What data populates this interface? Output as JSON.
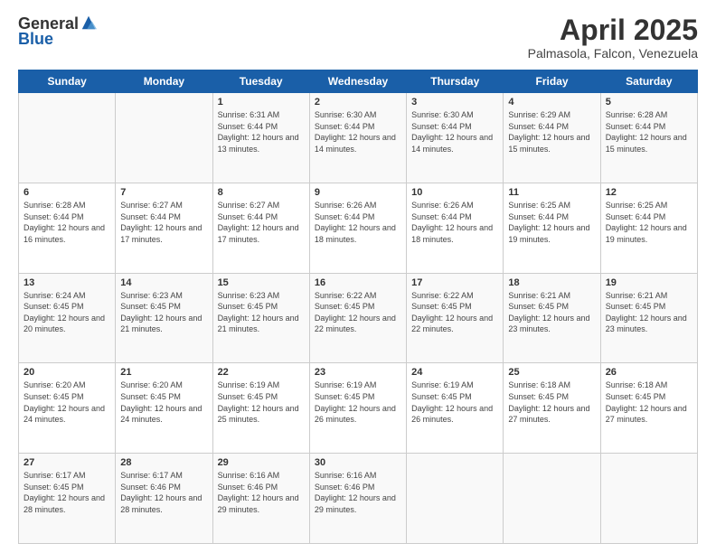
{
  "header": {
    "logo_general": "General",
    "logo_blue": "Blue",
    "month_year": "April 2025",
    "location": "Palmasola, Falcon, Venezuela"
  },
  "weekdays": [
    "Sunday",
    "Monday",
    "Tuesday",
    "Wednesday",
    "Thursday",
    "Friday",
    "Saturday"
  ],
  "weeks": [
    [
      {
        "day": "",
        "sunrise": "",
        "sunset": "",
        "daylight": ""
      },
      {
        "day": "",
        "sunrise": "",
        "sunset": "",
        "daylight": ""
      },
      {
        "day": "1",
        "sunrise": "Sunrise: 6:31 AM",
        "sunset": "Sunset: 6:44 PM",
        "daylight": "Daylight: 12 hours and 13 minutes."
      },
      {
        "day": "2",
        "sunrise": "Sunrise: 6:30 AM",
        "sunset": "Sunset: 6:44 PM",
        "daylight": "Daylight: 12 hours and 14 minutes."
      },
      {
        "day": "3",
        "sunrise": "Sunrise: 6:30 AM",
        "sunset": "Sunset: 6:44 PM",
        "daylight": "Daylight: 12 hours and 14 minutes."
      },
      {
        "day": "4",
        "sunrise": "Sunrise: 6:29 AM",
        "sunset": "Sunset: 6:44 PM",
        "daylight": "Daylight: 12 hours and 15 minutes."
      },
      {
        "day": "5",
        "sunrise": "Sunrise: 6:28 AM",
        "sunset": "Sunset: 6:44 PM",
        "daylight": "Daylight: 12 hours and 15 minutes."
      }
    ],
    [
      {
        "day": "6",
        "sunrise": "Sunrise: 6:28 AM",
        "sunset": "Sunset: 6:44 PM",
        "daylight": "Daylight: 12 hours and 16 minutes."
      },
      {
        "day": "7",
        "sunrise": "Sunrise: 6:27 AM",
        "sunset": "Sunset: 6:44 PM",
        "daylight": "Daylight: 12 hours and 17 minutes."
      },
      {
        "day": "8",
        "sunrise": "Sunrise: 6:27 AM",
        "sunset": "Sunset: 6:44 PM",
        "daylight": "Daylight: 12 hours and 17 minutes."
      },
      {
        "day": "9",
        "sunrise": "Sunrise: 6:26 AM",
        "sunset": "Sunset: 6:44 PM",
        "daylight": "Daylight: 12 hours and 18 minutes."
      },
      {
        "day": "10",
        "sunrise": "Sunrise: 6:26 AM",
        "sunset": "Sunset: 6:44 PM",
        "daylight": "Daylight: 12 hours and 18 minutes."
      },
      {
        "day": "11",
        "sunrise": "Sunrise: 6:25 AM",
        "sunset": "Sunset: 6:44 PM",
        "daylight": "Daylight: 12 hours and 19 minutes."
      },
      {
        "day": "12",
        "sunrise": "Sunrise: 6:25 AM",
        "sunset": "Sunset: 6:44 PM",
        "daylight": "Daylight: 12 hours and 19 minutes."
      }
    ],
    [
      {
        "day": "13",
        "sunrise": "Sunrise: 6:24 AM",
        "sunset": "Sunset: 6:45 PM",
        "daylight": "Daylight: 12 hours and 20 minutes."
      },
      {
        "day": "14",
        "sunrise": "Sunrise: 6:23 AM",
        "sunset": "Sunset: 6:45 PM",
        "daylight": "Daylight: 12 hours and 21 minutes."
      },
      {
        "day": "15",
        "sunrise": "Sunrise: 6:23 AM",
        "sunset": "Sunset: 6:45 PM",
        "daylight": "Daylight: 12 hours and 21 minutes."
      },
      {
        "day": "16",
        "sunrise": "Sunrise: 6:22 AM",
        "sunset": "Sunset: 6:45 PM",
        "daylight": "Daylight: 12 hours and 22 minutes."
      },
      {
        "day": "17",
        "sunrise": "Sunrise: 6:22 AM",
        "sunset": "Sunset: 6:45 PM",
        "daylight": "Daylight: 12 hours and 22 minutes."
      },
      {
        "day": "18",
        "sunrise": "Sunrise: 6:21 AM",
        "sunset": "Sunset: 6:45 PM",
        "daylight": "Daylight: 12 hours and 23 minutes."
      },
      {
        "day": "19",
        "sunrise": "Sunrise: 6:21 AM",
        "sunset": "Sunset: 6:45 PM",
        "daylight": "Daylight: 12 hours and 23 minutes."
      }
    ],
    [
      {
        "day": "20",
        "sunrise": "Sunrise: 6:20 AM",
        "sunset": "Sunset: 6:45 PM",
        "daylight": "Daylight: 12 hours and 24 minutes."
      },
      {
        "day": "21",
        "sunrise": "Sunrise: 6:20 AM",
        "sunset": "Sunset: 6:45 PM",
        "daylight": "Daylight: 12 hours and 24 minutes."
      },
      {
        "day": "22",
        "sunrise": "Sunrise: 6:19 AM",
        "sunset": "Sunset: 6:45 PM",
        "daylight": "Daylight: 12 hours and 25 minutes."
      },
      {
        "day": "23",
        "sunrise": "Sunrise: 6:19 AM",
        "sunset": "Sunset: 6:45 PM",
        "daylight": "Daylight: 12 hours and 26 minutes."
      },
      {
        "day": "24",
        "sunrise": "Sunrise: 6:19 AM",
        "sunset": "Sunset: 6:45 PM",
        "daylight": "Daylight: 12 hours and 26 minutes."
      },
      {
        "day": "25",
        "sunrise": "Sunrise: 6:18 AM",
        "sunset": "Sunset: 6:45 PM",
        "daylight": "Daylight: 12 hours and 27 minutes."
      },
      {
        "day": "26",
        "sunrise": "Sunrise: 6:18 AM",
        "sunset": "Sunset: 6:45 PM",
        "daylight": "Daylight: 12 hours and 27 minutes."
      }
    ],
    [
      {
        "day": "27",
        "sunrise": "Sunrise: 6:17 AM",
        "sunset": "Sunset: 6:45 PM",
        "daylight": "Daylight: 12 hours and 28 minutes."
      },
      {
        "day": "28",
        "sunrise": "Sunrise: 6:17 AM",
        "sunset": "Sunset: 6:46 PM",
        "daylight": "Daylight: 12 hours and 28 minutes."
      },
      {
        "day": "29",
        "sunrise": "Sunrise: 6:16 AM",
        "sunset": "Sunset: 6:46 PM",
        "daylight": "Daylight: 12 hours and 29 minutes."
      },
      {
        "day": "30",
        "sunrise": "Sunrise: 6:16 AM",
        "sunset": "Sunset: 6:46 PM",
        "daylight": "Daylight: 12 hours and 29 minutes."
      },
      {
        "day": "",
        "sunrise": "",
        "sunset": "",
        "daylight": ""
      },
      {
        "day": "",
        "sunrise": "",
        "sunset": "",
        "daylight": ""
      },
      {
        "day": "",
        "sunrise": "",
        "sunset": "",
        "daylight": ""
      }
    ]
  ]
}
